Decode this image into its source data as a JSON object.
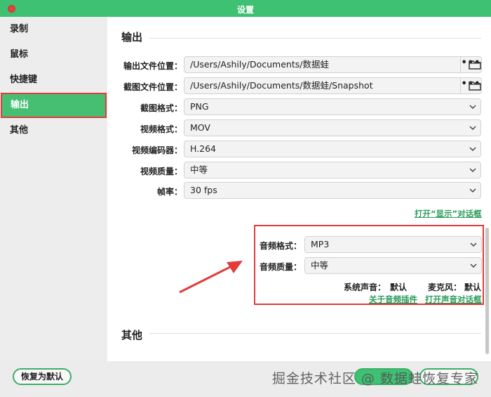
{
  "window": {
    "title": "设置"
  },
  "sidebar": {
    "items": [
      {
        "label": "录制"
      },
      {
        "label": "鼠标"
      },
      {
        "label": "快捷键"
      },
      {
        "label": "输出",
        "active": true
      },
      {
        "label": "其他"
      }
    ]
  },
  "output": {
    "section_title": "输出",
    "output_path_label": "输出文件位置：",
    "output_path_value": "/Users/Ashily/Documents/数据蛙",
    "snapshot_path_label": "截图文件位置：",
    "snapshot_path_value": "/Users/Ashily/Documents/数据蛙/Snapshot",
    "browse_label": "•••",
    "screenshot_format_label": "截图格式：",
    "screenshot_format_value": "PNG",
    "video_format_label": "视频格式：",
    "video_format_value": "MOV",
    "video_codec_label": "视频编码器：",
    "video_codec_value": "H.264",
    "video_quality_label": "视频质量：",
    "video_quality_value": "中等",
    "framerate_label": "帧率：",
    "framerate_value": "30 fps",
    "open_display_link": "打开“显示”对话框"
  },
  "audio": {
    "format_label": "音频格式：",
    "format_value": "MP3",
    "quality_label": "音频质量：",
    "quality_value": "中等",
    "system_sound_label": "系统声音：",
    "system_sound_value": "默认",
    "mic_label": "麦克风：",
    "mic_value": "默认",
    "plugin_link": "关于音频插件",
    "sound_dialog_link": "打开声音对话框"
  },
  "other": {
    "section_title": "其他"
  },
  "footer": {
    "reset_label": "恢复为默认",
    "watermark": "掘金技术社区 @ 数据蛙恢复专家"
  },
  "colors": {
    "accent": "#3ec173",
    "highlight": "#e23b3b",
    "link": "#2a9b5a"
  }
}
